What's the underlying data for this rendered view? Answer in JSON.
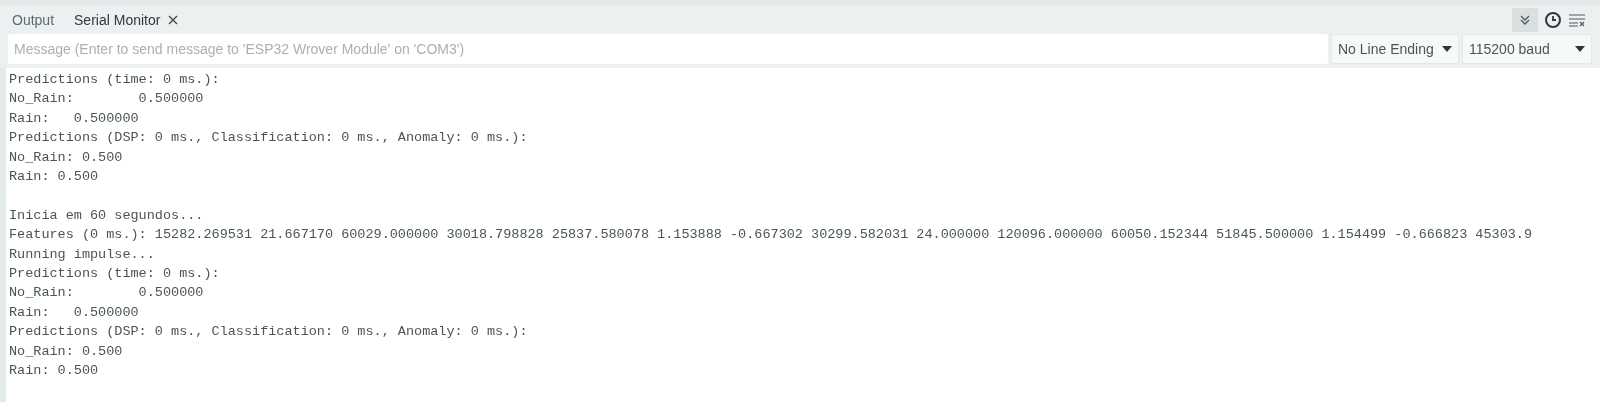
{
  "tabs": [
    {
      "label": "Output",
      "selected": false,
      "closable": false
    },
    {
      "label": "Serial Monitor",
      "selected": true,
      "closable": true
    }
  ],
  "toolbar": {
    "autoscroll_on": true
  },
  "message": {
    "placeholder": "Message (Enter to send message to 'ESP32 Wrover Module' on 'COM3')"
  },
  "line_ending": {
    "value": "No Line Ending"
  },
  "baud_rate": {
    "value": "115200 baud"
  },
  "output_blocks": [
    [
      "Predictions (time: 0 ms.):",
      "No_Rain:        0.500000",
      "Rain:   0.500000",
      "Predictions (DSP: 0 ms., Classification: 0 ms., Anomaly: 0 ms.):",
      "No_Rain: 0.500",
      "Rain: 0.500"
    ],
    [
      "Inicia em 60 segundos...",
      "Features (0 ms.): 15282.269531 21.667170 60029.000000 30018.798828 25837.580078 1.153888 -0.667302 30299.582031 24.000000 120096.000000 60050.152344 51845.500000 1.154499 -0.666823 45303.9",
      "Running impulse...",
      "Predictions (time: 0 ms.):",
      "No_Rain:        0.500000",
      "Rain:   0.500000",
      "Predictions (DSP: 0 ms., Classification: 0 ms., Anomaly: 0 ms.):",
      "No_Rain: 0.500",
      "Rain: 0.500"
    ]
  ]
}
